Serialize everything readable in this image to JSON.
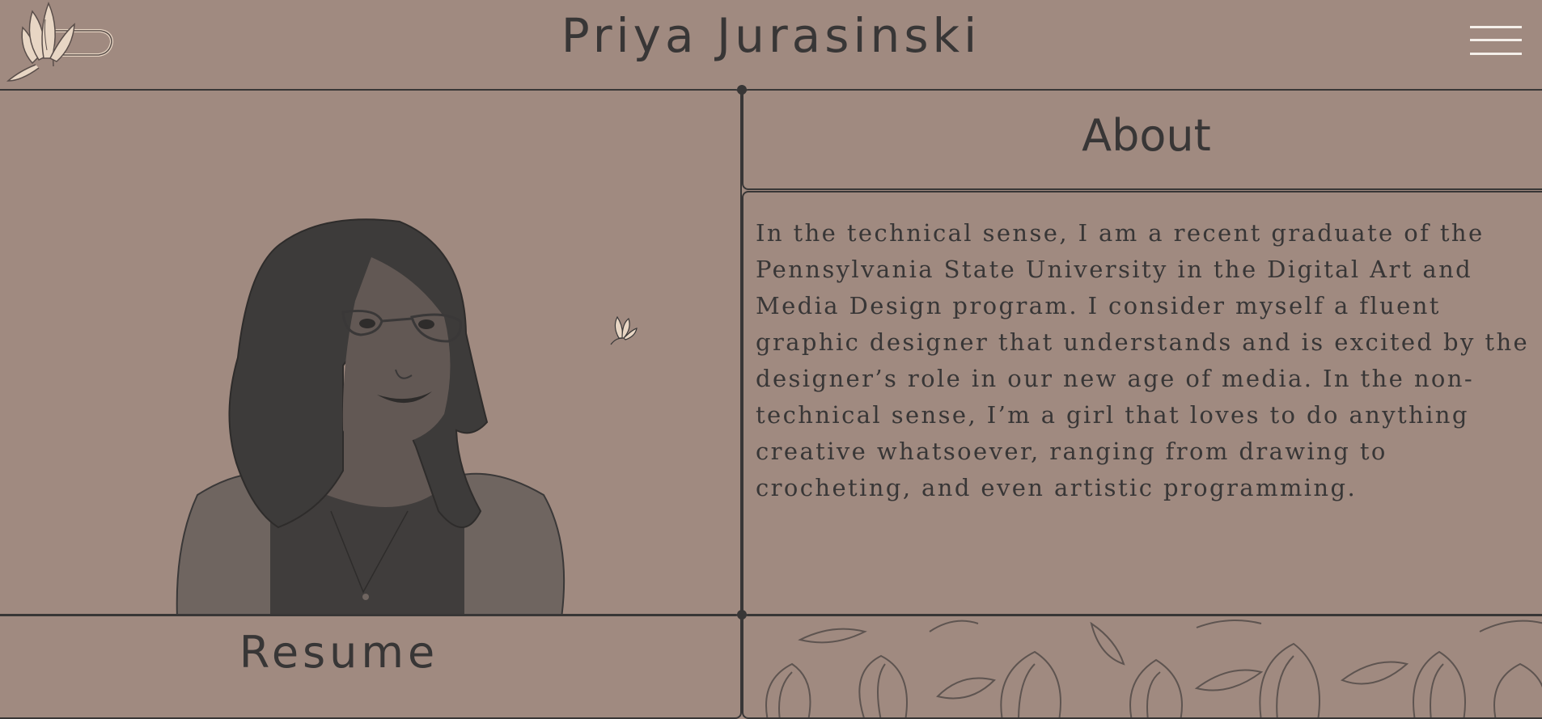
{
  "header": {
    "title": "Priya Jurasinski"
  },
  "icons": {
    "logo": "magnolia-logo",
    "menu": "hamburger-menu-icon",
    "flower": "magnolia-icon"
  },
  "about": {
    "heading": "About",
    "body": "In the technical sense, I am a recent graduate of the Pennsylvania State University in the Digital Art and Media Design program. I consider myself a fluent graphic designer that understands and is excited by the designer’s role in our new age of media. In the non-technical sense, I’m a girl that loves to do anything creative whatsoever, ranging from drawing to crocheting, and even artistic programming."
  },
  "resume": {
    "heading": "Resume"
  },
  "colors": {
    "background": "#a08a80",
    "ink": "#383636",
    "menu_lines": "#f4efe9",
    "logo_fill": "#e8d6c4"
  }
}
